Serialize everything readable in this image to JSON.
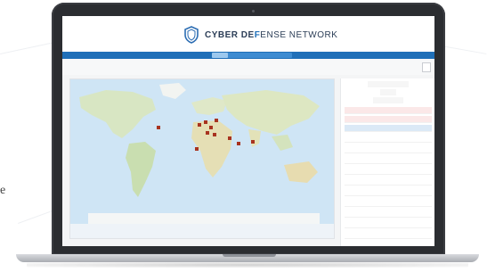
{
  "page": {
    "side_letter": "e"
  },
  "app": {
    "brand_strong": "CYBER DE",
    "brand_highlight": "F",
    "brand_rest": "ENSE NETWORK",
    "accent": "#1f6fb8",
    "alert_color": "#a8331f"
  },
  "icons": [
    "shield-logo-icon",
    "window-icon"
  ]
}
